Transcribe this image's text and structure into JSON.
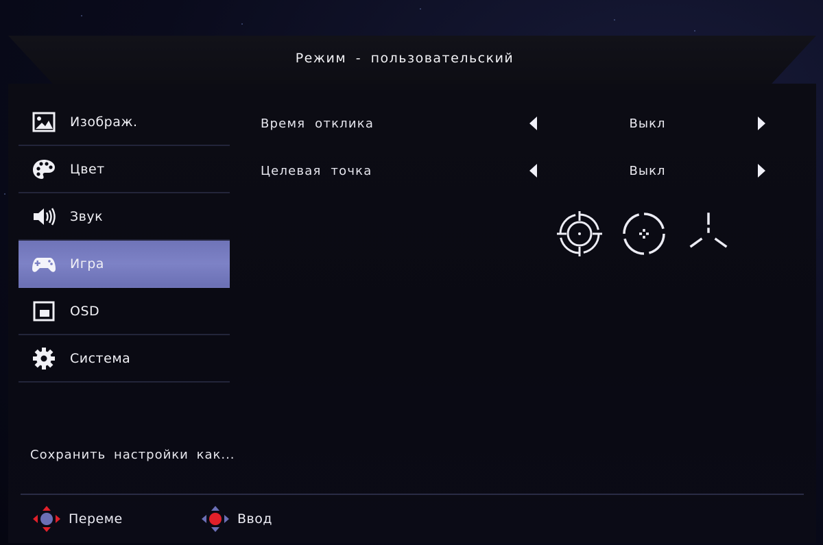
{
  "header": {
    "title": "Режим - пользовательский"
  },
  "sidebar": {
    "items": [
      {
        "label": "Изображ.",
        "icon": "picture-icon",
        "selected": false
      },
      {
        "label": "Цвет",
        "icon": "palette-icon",
        "selected": false
      },
      {
        "label": "Звук",
        "icon": "speaker-icon",
        "selected": false
      },
      {
        "label": "Игра",
        "icon": "gamepad-icon",
        "selected": true
      },
      {
        "label": "OSD",
        "icon": "osd-window-icon",
        "selected": false
      },
      {
        "label": "Система",
        "icon": "gear-icon",
        "selected": false
      }
    ],
    "save_label": "Сохранить настройки как..."
  },
  "settings": [
    {
      "label": "Время отклика",
      "value": "Выкл"
    },
    {
      "label": "Целевая точка",
      "value": "Выкл"
    }
  ],
  "reticles": [
    {
      "icon": "crosshair-reticle-icon"
    },
    {
      "icon": "circle-dot-reticle-icon"
    },
    {
      "icon": "tri-line-reticle-icon"
    }
  ],
  "footer": {
    "move_label": "Переме",
    "enter_label": "Ввод"
  },
  "colors": {
    "selected_bg": "#7a7fc2",
    "dpad_active": "#e0202a",
    "dpad_inactive": "#6b6fb5"
  }
}
